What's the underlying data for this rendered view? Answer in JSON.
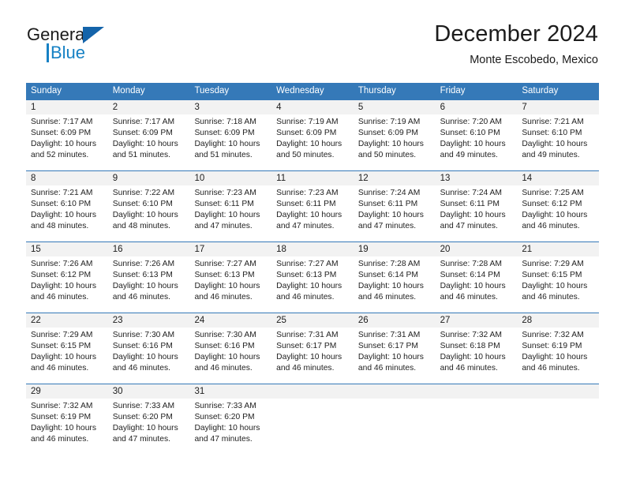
{
  "brand": {
    "name_part1": "General",
    "name_part2": "Blue",
    "logo_icon": "triangle-icon"
  },
  "header": {
    "title": "December 2024",
    "subtitle": "Monte Escobedo, Mexico"
  },
  "colors": {
    "header_blue": "#3579b8",
    "brand_blue": "#1681c4",
    "logo_blue": "#1464aa",
    "daynum_band": "#f2f2f2",
    "text": "#222222"
  },
  "weekdays": [
    "Sunday",
    "Monday",
    "Tuesday",
    "Wednesday",
    "Thursday",
    "Friday",
    "Saturday"
  ],
  "weeks": [
    {
      "daynums": [
        "1",
        "2",
        "3",
        "4",
        "5",
        "6",
        "7"
      ],
      "days": [
        {
          "sunrise": "Sunrise: 7:17 AM",
          "sunset": "Sunset: 6:09 PM",
          "daylight1": "Daylight: 10 hours",
          "daylight2": "and 52 minutes."
        },
        {
          "sunrise": "Sunrise: 7:17 AM",
          "sunset": "Sunset: 6:09 PM",
          "daylight1": "Daylight: 10 hours",
          "daylight2": "and 51 minutes."
        },
        {
          "sunrise": "Sunrise: 7:18 AM",
          "sunset": "Sunset: 6:09 PM",
          "daylight1": "Daylight: 10 hours",
          "daylight2": "and 51 minutes."
        },
        {
          "sunrise": "Sunrise: 7:19 AM",
          "sunset": "Sunset: 6:09 PM",
          "daylight1": "Daylight: 10 hours",
          "daylight2": "and 50 minutes."
        },
        {
          "sunrise": "Sunrise: 7:19 AM",
          "sunset": "Sunset: 6:09 PM",
          "daylight1": "Daylight: 10 hours",
          "daylight2": "and 50 minutes."
        },
        {
          "sunrise": "Sunrise: 7:20 AM",
          "sunset": "Sunset: 6:10 PM",
          "daylight1": "Daylight: 10 hours",
          "daylight2": "and 49 minutes."
        },
        {
          "sunrise": "Sunrise: 7:21 AM",
          "sunset": "Sunset: 6:10 PM",
          "daylight1": "Daylight: 10 hours",
          "daylight2": "and 49 minutes."
        }
      ]
    },
    {
      "daynums": [
        "8",
        "9",
        "10",
        "11",
        "12",
        "13",
        "14"
      ],
      "days": [
        {
          "sunrise": "Sunrise: 7:21 AM",
          "sunset": "Sunset: 6:10 PM",
          "daylight1": "Daylight: 10 hours",
          "daylight2": "and 48 minutes."
        },
        {
          "sunrise": "Sunrise: 7:22 AM",
          "sunset": "Sunset: 6:10 PM",
          "daylight1": "Daylight: 10 hours",
          "daylight2": "and 48 minutes."
        },
        {
          "sunrise": "Sunrise: 7:23 AM",
          "sunset": "Sunset: 6:11 PM",
          "daylight1": "Daylight: 10 hours",
          "daylight2": "and 47 minutes."
        },
        {
          "sunrise": "Sunrise: 7:23 AM",
          "sunset": "Sunset: 6:11 PM",
          "daylight1": "Daylight: 10 hours",
          "daylight2": "and 47 minutes."
        },
        {
          "sunrise": "Sunrise: 7:24 AM",
          "sunset": "Sunset: 6:11 PM",
          "daylight1": "Daylight: 10 hours",
          "daylight2": "and 47 minutes."
        },
        {
          "sunrise": "Sunrise: 7:24 AM",
          "sunset": "Sunset: 6:11 PM",
          "daylight1": "Daylight: 10 hours",
          "daylight2": "and 47 minutes."
        },
        {
          "sunrise": "Sunrise: 7:25 AM",
          "sunset": "Sunset: 6:12 PM",
          "daylight1": "Daylight: 10 hours",
          "daylight2": "and 46 minutes."
        }
      ]
    },
    {
      "daynums": [
        "15",
        "16",
        "17",
        "18",
        "19",
        "20",
        "21"
      ],
      "days": [
        {
          "sunrise": "Sunrise: 7:26 AM",
          "sunset": "Sunset: 6:12 PM",
          "daylight1": "Daylight: 10 hours",
          "daylight2": "and 46 minutes."
        },
        {
          "sunrise": "Sunrise: 7:26 AM",
          "sunset": "Sunset: 6:13 PM",
          "daylight1": "Daylight: 10 hours",
          "daylight2": "and 46 minutes."
        },
        {
          "sunrise": "Sunrise: 7:27 AM",
          "sunset": "Sunset: 6:13 PM",
          "daylight1": "Daylight: 10 hours",
          "daylight2": "and 46 minutes."
        },
        {
          "sunrise": "Sunrise: 7:27 AM",
          "sunset": "Sunset: 6:13 PM",
          "daylight1": "Daylight: 10 hours",
          "daylight2": "and 46 minutes."
        },
        {
          "sunrise": "Sunrise: 7:28 AM",
          "sunset": "Sunset: 6:14 PM",
          "daylight1": "Daylight: 10 hours",
          "daylight2": "and 46 minutes."
        },
        {
          "sunrise": "Sunrise: 7:28 AM",
          "sunset": "Sunset: 6:14 PM",
          "daylight1": "Daylight: 10 hours",
          "daylight2": "and 46 minutes."
        },
        {
          "sunrise": "Sunrise: 7:29 AM",
          "sunset": "Sunset: 6:15 PM",
          "daylight1": "Daylight: 10 hours",
          "daylight2": "and 46 minutes."
        }
      ]
    },
    {
      "daynums": [
        "22",
        "23",
        "24",
        "25",
        "26",
        "27",
        "28"
      ],
      "days": [
        {
          "sunrise": "Sunrise: 7:29 AM",
          "sunset": "Sunset: 6:15 PM",
          "daylight1": "Daylight: 10 hours",
          "daylight2": "and 46 minutes."
        },
        {
          "sunrise": "Sunrise: 7:30 AM",
          "sunset": "Sunset: 6:16 PM",
          "daylight1": "Daylight: 10 hours",
          "daylight2": "and 46 minutes."
        },
        {
          "sunrise": "Sunrise: 7:30 AM",
          "sunset": "Sunset: 6:16 PM",
          "daylight1": "Daylight: 10 hours",
          "daylight2": "and 46 minutes."
        },
        {
          "sunrise": "Sunrise: 7:31 AM",
          "sunset": "Sunset: 6:17 PM",
          "daylight1": "Daylight: 10 hours",
          "daylight2": "and 46 minutes."
        },
        {
          "sunrise": "Sunrise: 7:31 AM",
          "sunset": "Sunset: 6:17 PM",
          "daylight1": "Daylight: 10 hours",
          "daylight2": "and 46 minutes."
        },
        {
          "sunrise": "Sunrise: 7:32 AM",
          "sunset": "Sunset: 6:18 PM",
          "daylight1": "Daylight: 10 hours",
          "daylight2": "and 46 minutes."
        },
        {
          "sunrise": "Sunrise: 7:32 AM",
          "sunset": "Sunset: 6:19 PM",
          "daylight1": "Daylight: 10 hours",
          "daylight2": "and 46 minutes."
        }
      ]
    },
    {
      "daynums": [
        "29",
        "30",
        "31",
        "",
        "",
        "",
        ""
      ],
      "days": [
        {
          "sunrise": "Sunrise: 7:32 AM",
          "sunset": "Sunset: 6:19 PM",
          "daylight1": "Daylight: 10 hours",
          "daylight2": "and 46 minutes."
        },
        {
          "sunrise": "Sunrise: 7:33 AM",
          "sunset": "Sunset: 6:20 PM",
          "daylight1": "Daylight: 10 hours",
          "daylight2": "and 47 minutes."
        },
        {
          "sunrise": "Sunrise: 7:33 AM",
          "sunset": "Sunset: 6:20 PM",
          "daylight1": "Daylight: 10 hours",
          "daylight2": "and 47 minutes."
        },
        {
          "sunrise": "",
          "sunset": "",
          "daylight1": "",
          "daylight2": ""
        },
        {
          "sunrise": "",
          "sunset": "",
          "daylight1": "",
          "daylight2": ""
        },
        {
          "sunrise": "",
          "sunset": "",
          "daylight1": "",
          "daylight2": ""
        },
        {
          "sunrise": "",
          "sunset": "",
          "daylight1": "",
          "daylight2": ""
        }
      ]
    }
  ]
}
